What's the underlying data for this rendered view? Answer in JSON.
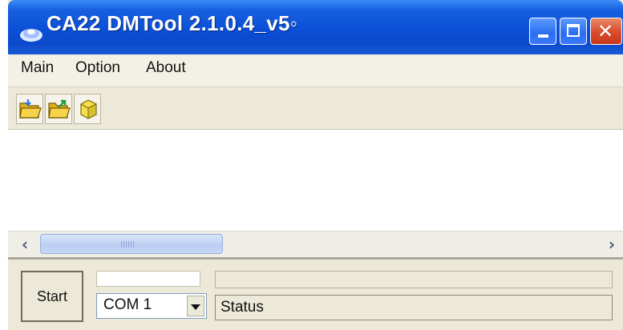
{
  "window": {
    "title": "CA22 DMTool 2.1.0.4_v5◦"
  },
  "menu": {
    "items": [
      "Main",
      "Option",
      "About"
    ]
  },
  "toolbar": {
    "icons": [
      "open-folder-icon",
      "export-folder-icon",
      "package-icon"
    ]
  },
  "controls": {
    "start_label": "Start",
    "port_value": "COM 1",
    "status_text": "Status"
  },
  "colors": {
    "titlebar": "#0b4acb",
    "chrome": "#ece9d8",
    "close": "#d8492a"
  }
}
